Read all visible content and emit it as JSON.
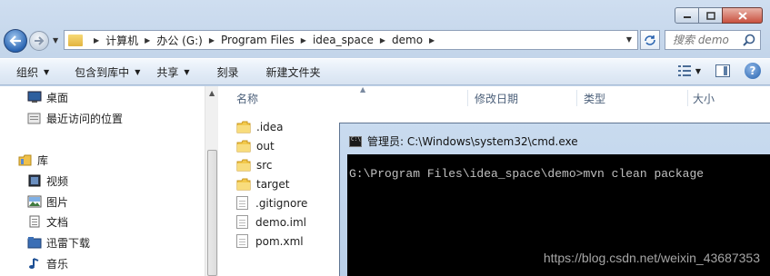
{
  "window": {
    "caption_buttons": [
      "minimize",
      "maximize",
      "close"
    ]
  },
  "address_bar": {
    "breadcrumbs": [
      "计算机",
      "办公 (G:)",
      "Program Files",
      "idea_space",
      "demo"
    ]
  },
  "search": {
    "placeholder": "搜索 demo"
  },
  "toolbar": {
    "organize": "组织",
    "include_in_library": "包含到库中",
    "share": "共享",
    "burn": "刻录",
    "new_folder": "新建文件夹"
  },
  "nav_pane": {
    "items": [
      {
        "label": "桌面",
        "icon": "desktop-icon"
      },
      {
        "label": "最近访问的位置",
        "icon": "recent-places-icon"
      },
      {
        "label": "库",
        "icon": "libraries-icon"
      },
      {
        "label": "视频",
        "icon": "videos-icon"
      },
      {
        "label": "图片",
        "icon": "pictures-icon"
      },
      {
        "label": "文档",
        "icon": "documents-icon"
      },
      {
        "label": "迅雷下载",
        "icon": "thunder-download-icon"
      },
      {
        "label": "音乐",
        "icon": "music-icon"
      }
    ]
  },
  "file_list": {
    "columns": [
      "名称",
      "修改日期",
      "类型",
      "大小"
    ],
    "files": [
      {
        "name": ".idea",
        "kind": "folder"
      },
      {
        "name": "out",
        "kind": "folder"
      },
      {
        "name": "src",
        "kind": "folder"
      },
      {
        "name": "target",
        "kind": "folder"
      },
      {
        "name": ".gitignore",
        "kind": "file"
      },
      {
        "name": "demo.iml",
        "kind": "file"
      },
      {
        "name": "pom.xml",
        "kind": "file"
      }
    ]
  },
  "cmd_window": {
    "title": "管理员: C:\\Windows\\system32\\cmd.exe",
    "command_line": "G:\\Program Files\\idea_space\\demo>mvn clean package",
    "watermark": "https://blog.csdn.net/weixin_43687353"
  },
  "colors": {
    "chrome": "#cfdef0",
    "folder": "#f2c94c",
    "cmd_background": "#000000",
    "cmd_text": "#c0c0c0"
  }
}
